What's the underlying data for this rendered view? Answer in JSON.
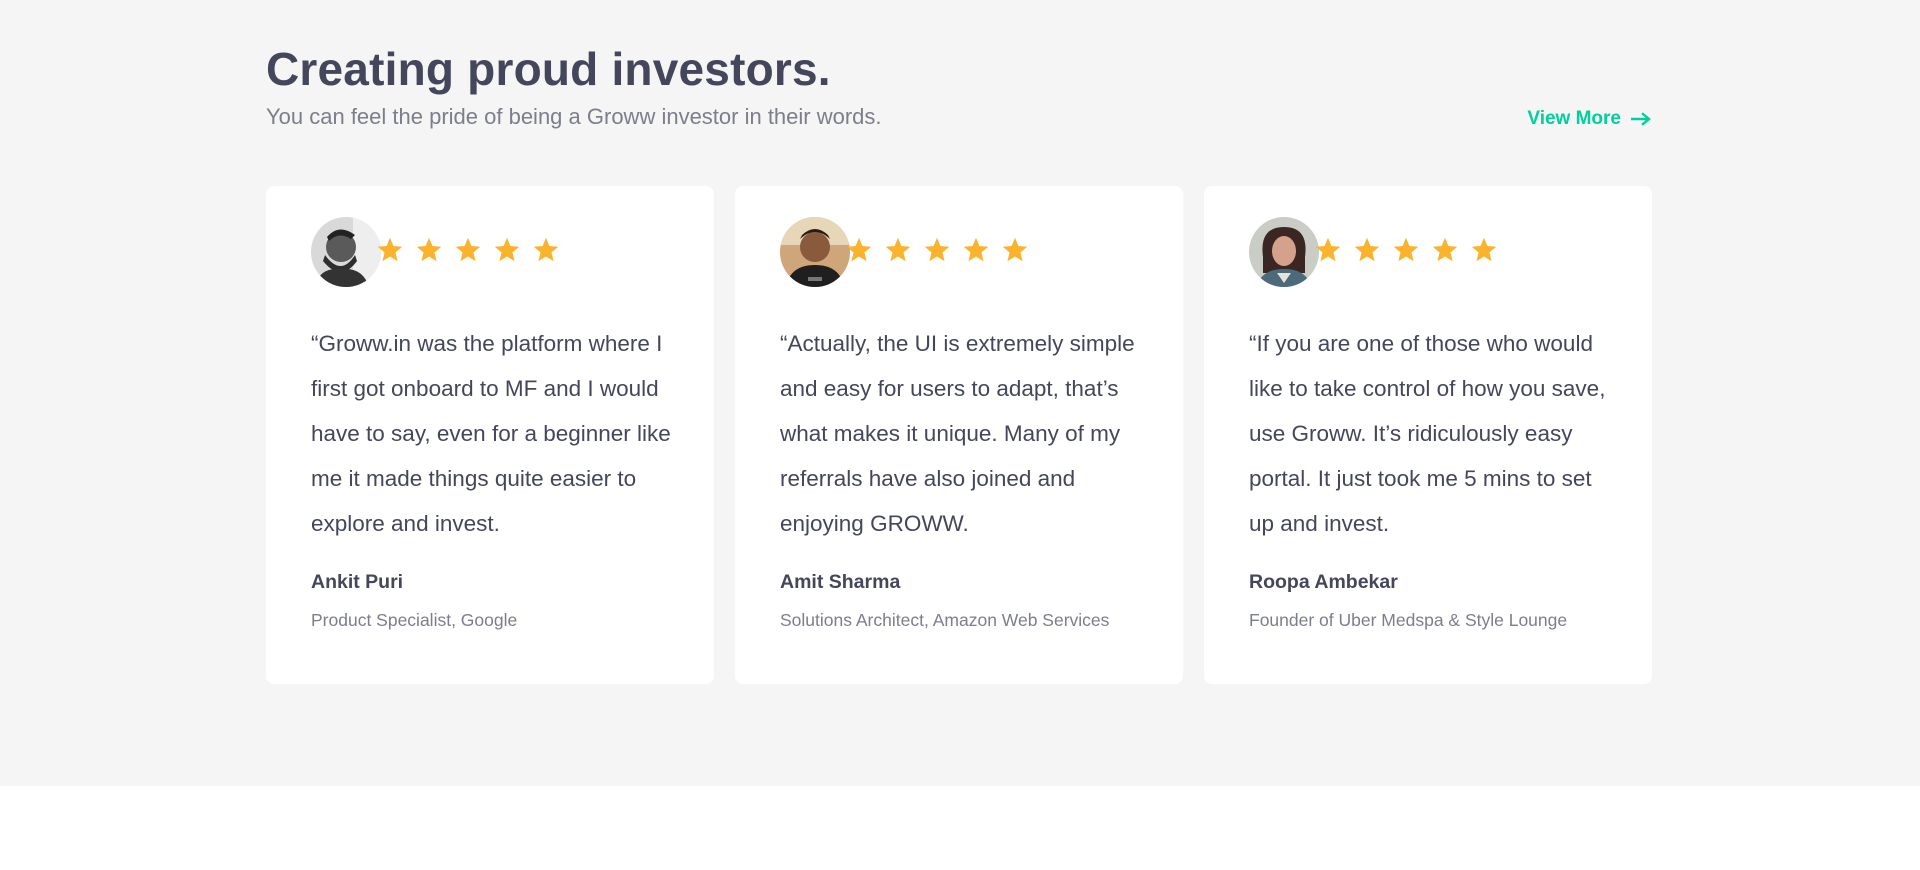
{
  "header": {
    "title": "Creating proud investors.",
    "subtitle": "You can feel the pride of being a Groww investor in their words.",
    "view_more_label": "View More",
    "view_more_icon": "arrow-right-icon"
  },
  "colors": {
    "accent": "#00d09c",
    "star": "#fbb32d",
    "heading": "#44475b",
    "muted": "#7c7e8c",
    "section_bg": "#f5f5f5",
    "card_bg": "#ffffff"
  },
  "testimonials": [
    {
      "quote": "“Groww.in was the platform where I first got onboard to MF and I would have to say, even for a beginner like me it made things quite easier to explore and invest.",
      "name": "Ankit Puri",
      "role": "Product Specialist, Google",
      "rating": 5,
      "avatar_icon": "user-photo"
    },
    {
      "quote": "“Actually, the UI is extremely simple and easy for users to adapt, that’s what makes it unique. Many of my referrals have also joined and enjoying GROWW.",
      "name": "Amit Sharma",
      "role": "Solutions Architect, Amazon Web Services",
      "rating": 5,
      "avatar_icon": "user-photo"
    },
    {
      "quote": "“If you are one of those who would like to take control of how you save, use Groww. It’s ridiculously easy portal. It just took me 5 mins to set up and invest.",
      "name": "Roopa Ambekar",
      "role": "Founder of Uber Medspa & Style Lounge",
      "rating": 5,
      "avatar_icon": "user-photo"
    }
  ]
}
